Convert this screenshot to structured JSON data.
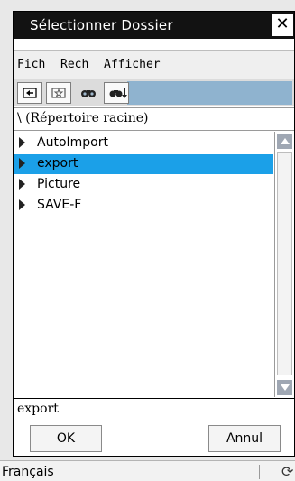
{
  "dialog": {
    "title": "Sélectionner Dossier",
    "close_glyph": "✕"
  },
  "menu": {
    "items": [
      "Fich",
      "Rech",
      "Afficher"
    ]
  },
  "toolbar": {
    "buttons": [
      "folder-up-icon",
      "new-folder-icon",
      "find-icon",
      "find-next-icon"
    ]
  },
  "path": {
    "text": "\\  (Répertoire racine)"
  },
  "list": {
    "items": [
      {
        "label": "AutoImport",
        "selected": false
      },
      {
        "label": "export",
        "selected": true
      },
      {
        "label": "Picture",
        "selected": false
      },
      {
        "label": "SAVE-F",
        "selected": false
      }
    ],
    "selection_color": "#1ba0e8"
  },
  "filename": {
    "value": "export"
  },
  "buttons": {
    "ok": "OK",
    "cancel": "Annul"
  },
  "status": {
    "language": "Français",
    "icon": "refresh-icon"
  }
}
